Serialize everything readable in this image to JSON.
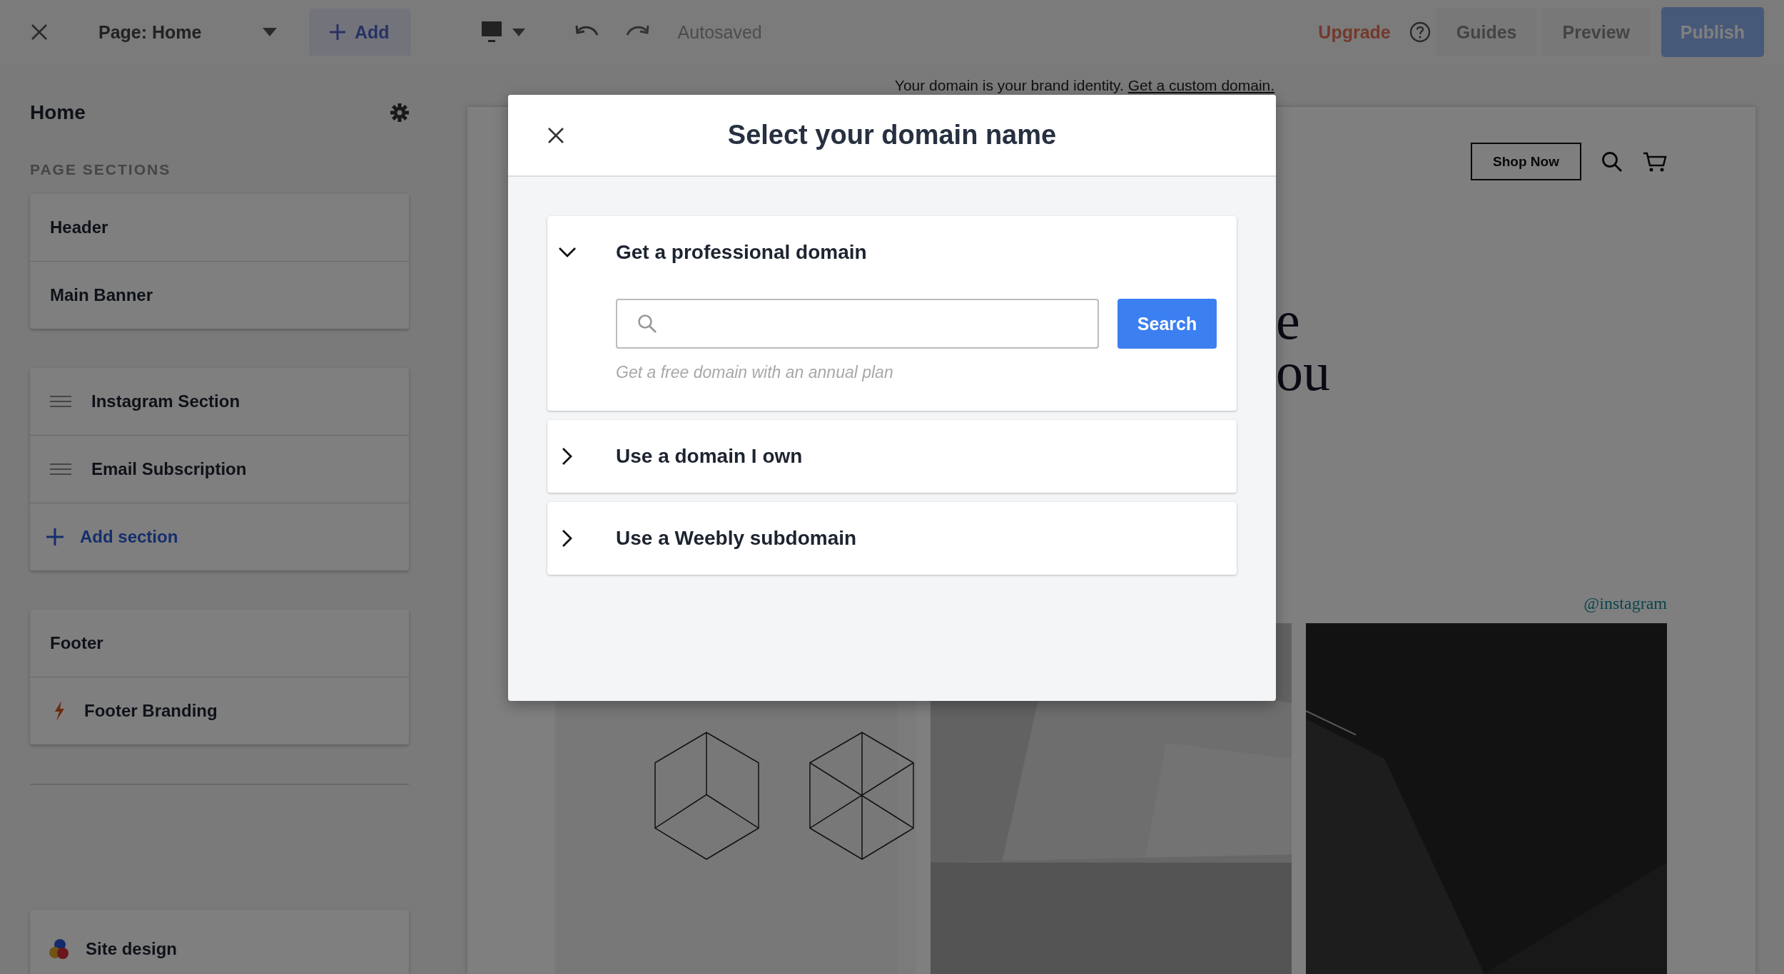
{
  "top_bar": {
    "page_selector": "Page: Home",
    "add_button": "Add",
    "autosave_status": "Autosaved",
    "upgrade_link": "Upgrade",
    "guides_button": "Guides",
    "preview_button": "Preview",
    "publish_button": "Publish"
  },
  "sidebar": {
    "title": "Home",
    "section_label": "PAGE SECTIONS",
    "groups": [
      {
        "items": [
          {
            "label": "Header",
            "kind": "plain"
          },
          {
            "label": "Main Banner",
            "kind": "plain"
          }
        ]
      },
      {
        "items": [
          {
            "label": "Instagram Section",
            "kind": "draggable"
          },
          {
            "label": "Email Subscription",
            "kind": "draggable"
          },
          {
            "label": "Add section",
            "kind": "add"
          }
        ]
      },
      {
        "items": [
          {
            "label": "Footer",
            "kind": "plain"
          },
          {
            "label": "Footer Branding",
            "kind": "branding"
          }
        ]
      }
    ],
    "site_design": "Site design"
  },
  "banner": {
    "text": "Your domain is your brand identity.",
    "link": "Get a custom domain."
  },
  "preview": {
    "shop_button": "Shop Now",
    "hero_lines": [
      "e",
      "ou"
    ],
    "instagram_handle": "@instagram",
    "photos": [
      {
        "kind": "picture"
      },
      {
        "kind": "picture"
      },
      {
        "kind": "picture"
      }
    ]
  },
  "modal": {
    "title": "Select your domain name",
    "options": [
      {
        "label": "Get a professional domain",
        "expanded": true,
        "search_button": "Search",
        "hint": "Get a free domain with an annual plan"
      },
      {
        "label": "Use a domain I own",
        "expanded": false
      },
      {
        "label": "Use a Weebly subdomain",
        "expanded": false
      }
    ]
  }
}
